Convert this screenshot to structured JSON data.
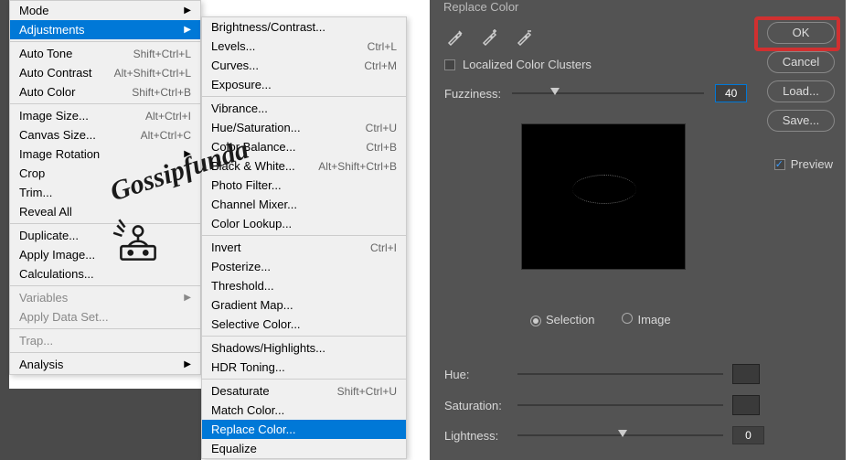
{
  "mainMenu": {
    "items": [
      {
        "label": "Mode",
        "arrow": true
      },
      {
        "label": "Adjustments",
        "arrow": true,
        "highlight": true
      },
      {
        "sep": true
      },
      {
        "label": "Auto Tone",
        "shortcut": "Shift+Ctrl+L"
      },
      {
        "label": "Auto Contrast",
        "shortcut": "Alt+Shift+Ctrl+L"
      },
      {
        "label": "Auto Color",
        "shortcut": "Shift+Ctrl+B"
      },
      {
        "sep": true
      },
      {
        "label": "Image Size...",
        "shortcut": "Alt+Ctrl+I"
      },
      {
        "label": "Canvas Size...",
        "shortcut": "Alt+Ctrl+C"
      },
      {
        "label": "Image Rotation",
        "arrow": true
      },
      {
        "label": "Crop"
      },
      {
        "label": "Trim..."
      },
      {
        "label": "Reveal All"
      },
      {
        "sep": true
      },
      {
        "label": "Duplicate..."
      },
      {
        "label": "Apply Image..."
      },
      {
        "label": "Calculations..."
      },
      {
        "sep": true
      },
      {
        "label": "Variables",
        "arrow": true,
        "disabled": true
      },
      {
        "label": "Apply Data Set...",
        "disabled": true
      },
      {
        "sep": true
      },
      {
        "label": "Trap...",
        "disabled": true
      },
      {
        "sep": true
      },
      {
        "label": "Analysis",
        "arrow": true
      }
    ]
  },
  "subMenu": {
    "items": [
      {
        "label": "Brightness/Contrast..."
      },
      {
        "label": "Levels...",
        "shortcut": "Ctrl+L"
      },
      {
        "label": "Curves...",
        "shortcut": "Ctrl+M"
      },
      {
        "label": "Exposure..."
      },
      {
        "sep": true
      },
      {
        "label": "Vibrance..."
      },
      {
        "label": "Hue/Saturation...",
        "shortcut": "Ctrl+U"
      },
      {
        "label": "Color Balance...",
        "shortcut": "Ctrl+B"
      },
      {
        "label": "Black & White...",
        "shortcut": "Alt+Shift+Ctrl+B"
      },
      {
        "label": "Photo Filter..."
      },
      {
        "label": "Channel Mixer..."
      },
      {
        "label": "Color Lookup..."
      },
      {
        "sep": true
      },
      {
        "label": "Invert",
        "shortcut": "Ctrl+I"
      },
      {
        "label": "Posterize..."
      },
      {
        "label": "Threshold..."
      },
      {
        "label": "Gradient Map..."
      },
      {
        "label": "Selective Color..."
      },
      {
        "sep": true
      },
      {
        "label": "Shadows/Highlights..."
      },
      {
        "label": "HDR Toning..."
      },
      {
        "sep": true
      },
      {
        "label": "Desaturate",
        "shortcut": "Shift+Ctrl+U"
      },
      {
        "label": "Match Color..."
      },
      {
        "label": "Replace Color...",
        "highlight": true
      },
      {
        "label": "Equalize"
      }
    ]
  },
  "dialog": {
    "title": "Replace Color",
    "localized": "Localized Color Clusters",
    "fuzziness_label": "Fuzziness:",
    "fuzziness_value": "40",
    "selection_label": "Selection",
    "image_label": "Image",
    "hue_label": "Hue:",
    "saturation_label": "Saturation:",
    "lightness_label": "Lightness:",
    "lightness_value": "0",
    "buttons": {
      "ok": "OK",
      "cancel": "Cancel",
      "load": "Load...",
      "save": "Save..."
    },
    "preview_label": "Preview"
  },
  "watermark": "Gossipfunda"
}
